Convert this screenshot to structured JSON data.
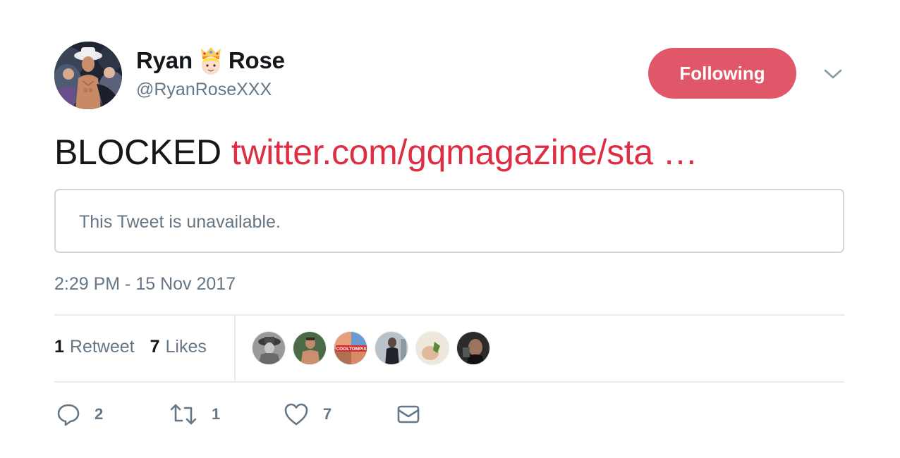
{
  "author": {
    "name_first": "Ryan",
    "name_last": "Rose",
    "name_emoji": "prince-emoji",
    "handle": "@RyanRoseXXX",
    "avatar": "profile-photo"
  },
  "follow_button": {
    "label": "Following",
    "color": "#e0576a"
  },
  "menu": {
    "icon": "chevron-down-icon"
  },
  "tweet": {
    "text": "BLOCKED",
    "link_text": "twitter.com/gqmagazine/sta …",
    "link_color": "#dd2e44"
  },
  "quoted_tweet": {
    "text": "This Tweet is unavailable."
  },
  "timestamp": "2:29 PM - 15 Nov 2017",
  "stats": {
    "retweets_count": "1",
    "retweets_label": "Retweet",
    "likes_count": "7",
    "likes_label": "Likes"
  },
  "likers": [
    {
      "name": "liker-avatar-1",
      "badge": ""
    },
    {
      "name": "liker-avatar-2",
      "badge": ""
    },
    {
      "name": "liker-avatar-3",
      "badge": "COOLTOMPIX"
    },
    {
      "name": "liker-avatar-4",
      "badge": ""
    },
    {
      "name": "liker-avatar-5",
      "badge": ""
    },
    {
      "name": "liker-avatar-6",
      "badge": ""
    }
  ],
  "actions": {
    "reply_icon": "reply-icon",
    "reply_count": "2",
    "retweet_icon": "retweet-icon",
    "retweet_count": "1",
    "like_icon": "heart-icon",
    "like_count": "7",
    "dm_icon": "envelope-icon"
  },
  "colors": {
    "text_secondary": "#657786",
    "border": "#ccd6dd",
    "divider": "#e6ecf0"
  }
}
